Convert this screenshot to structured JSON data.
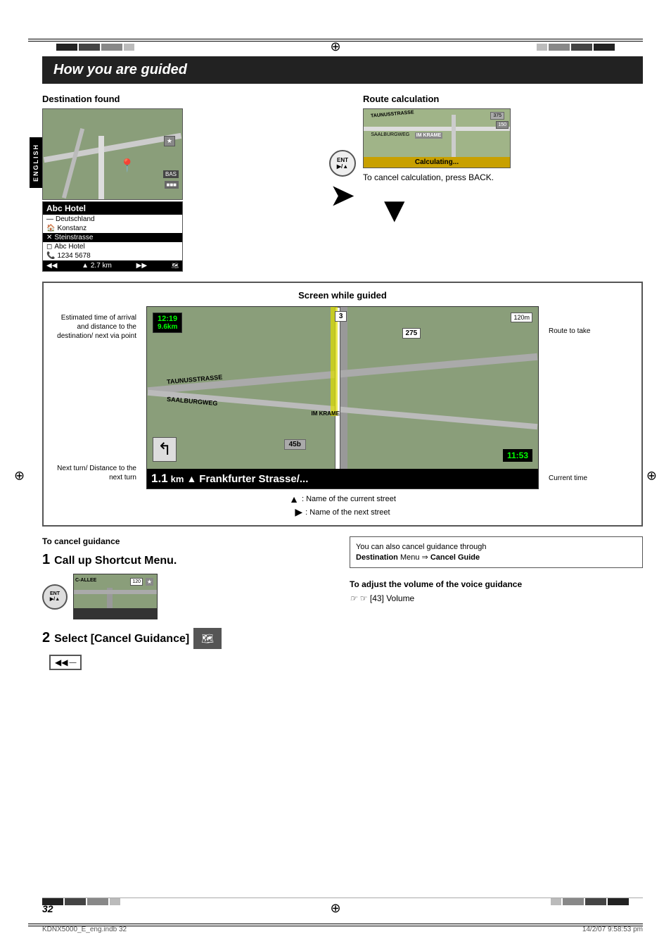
{
  "page": {
    "title": "How you are guided",
    "page_number": "32",
    "footer_file": "KDNX5000_E_eng.indb  32",
    "footer_date": "14/2/07  9:58:53 pm"
  },
  "sections": {
    "destination_found": {
      "header": "Destination found",
      "dest_name": "Abc Hotel",
      "dest_rows": [
        "— Deutschland",
        "▲ Konstanz",
        "✕ Steinstrasse",
        "◻ Abc Hotel",
        "✆ 1234 5678"
      ],
      "footer_distance": "▲  2.7 km"
    },
    "route_calculation": {
      "header": "Route calculation",
      "calculating_label": "Calculating...",
      "cancel_text": "To cancel calculation, press BACK."
    },
    "screen_guided": {
      "title": "Screen while guided",
      "label_left1": "Estimated time of arrival and distance to the destination/ next via point",
      "label_left2": "Next turn/ Distance to the next turn",
      "label_right1": "Route to take",
      "label_right2": "Current time",
      "time_display": "12:19",
      "distance_display": "9.6km",
      "current_time": "11:53",
      "turn_arrow": "↰",
      "road_number1": "3",
      "road_number2": "275",
      "distance_marker": "120m",
      "exit_number": "45b",
      "street_name1": "TAUNUSSTRASSE",
      "street_name2": "SAALBURGWEG",
      "bottom_street": "1.1 km ▲ Frankfurter Strasse/...",
      "street_km": "1.1",
      "street_label": "Frankfurter Strasse/...",
      "legend_current": ": Name of the current street",
      "legend_next": ": Name of the next street"
    },
    "cancel_guidance": {
      "header": "To cancel guidance",
      "step1_num": "1",
      "step1_text": "Call up Shortcut Menu.",
      "step2_num": "2",
      "step2_text": "Select [Cancel Guidance]",
      "also_cancel_text": "You can also cancel guidance through",
      "also_cancel_bold": "Destination",
      "also_cancel_menu": "Menu ⇒",
      "also_cancel_item": "Cancel Guide",
      "also_cancel_item_label": "Cancel Guide"
    },
    "voice_guidance": {
      "header": "To adjust the volume of the voice guidance",
      "ref_text": "☞ [43] Volume"
    }
  }
}
